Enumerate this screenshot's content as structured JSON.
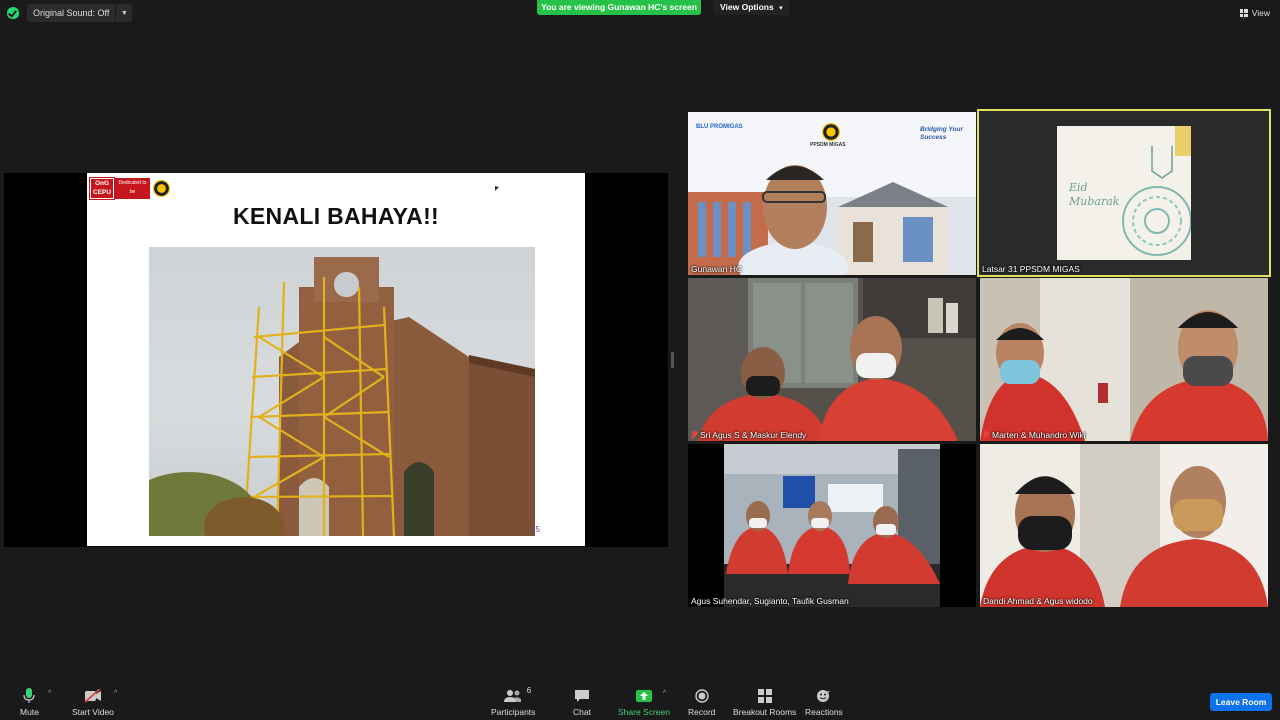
{
  "topbar": {
    "original_sound_label": "Original Sound: Off",
    "viewing_banner": "You are viewing Gunawan HC's screen",
    "view_options_label": "View Options",
    "view_label": "View"
  },
  "slide": {
    "logo_text_1": "OnG CEPU",
    "logo_text_2": "Dedicated to be COMPETENT",
    "title": "KENALI BAHAYA!!",
    "page_number": "55"
  },
  "tiles": [
    {
      "name": "Gunawan HC",
      "muted": false,
      "bg_label_1": "BLU PROMIGAS",
      "bg_label_2": "PPSDM MIGAS",
      "bg_label_3": "Bridging Your Success"
    },
    {
      "name": "Latsar 31 PPSDM MIGAS",
      "muted": false,
      "card_text": "Eid Mubarak"
    },
    {
      "name": "Sri Agus S & Maskur Elendy",
      "muted": true
    },
    {
      "name": "Marten & Muhandro Wiki",
      "muted": true
    },
    {
      "name": "Agus Suhendar, Sugianto, Taufik Gusman",
      "muted": false
    },
    {
      "name": "Dandi Ahmad & Agus widodo",
      "muted": false
    }
  ],
  "toolbar": {
    "mute_label": "Mute",
    "start_video_label": "Start Video",
    "participants_label": "Participants",
    "participants_count": "6",
    "chat_label": "Chat",
    "share_screen_label": "Share Screen",
    "record_label": "Record",
    "breakout_label": "Breakout Rooms",
    "reactions_label": "Reactions",
    "leave_label": "Leave Room"
  },
  "colors": {
    "background": "#1a1a1a",
    "banner_green": "#26c149",
    "active_speaker": "#e0e35a",
    "leave_blue": "#0e72ed",
    "muted_red": "#e04343"
  }
}
